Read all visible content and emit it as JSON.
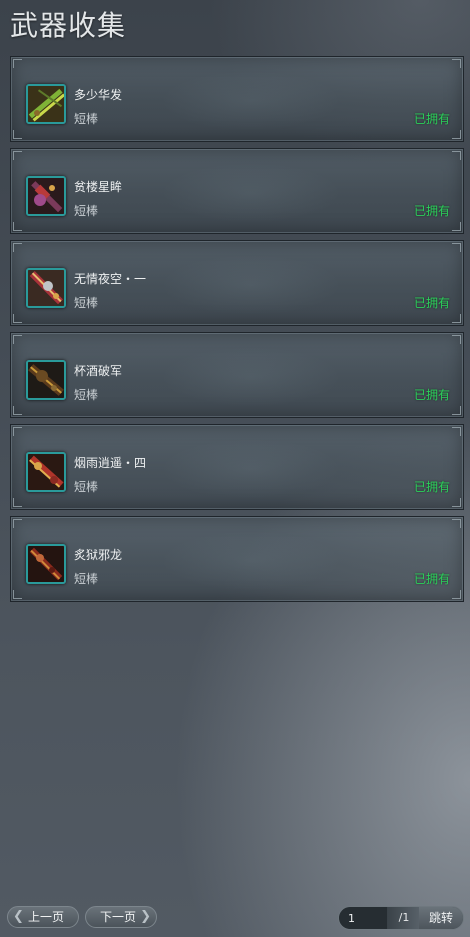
{
  "title": "武器收集",
  "weapons": [
    {
      "name": "多少华发",
      "type": "短棒",
      "status": "已拥有",
      "icon": "weapon-icon-green-rod"
    },
    {
      "name": "贫楼星眸",
      "type": "短棒",
      "status": "已拥有",
      "icon": "weapon-icon-red-purple-club"
    },
    {
      "name": "无情夜空・一",
      "type": "短棒",
      "status": "已拥有",
      "icon": "weapon-icon-red-gold-club"
    },
    {
      "name": "杯酒破军",
      "type": "短棒",
      "status": "已拥有",
      "icon": "weapon-icon-dark-brown-club"
    },
    {
      "name": "烟雨逍遥・四",
      "type": "短棒",
      "status": "已拥有",
      "icon": "weapon-icon-red-gold-rod"
    },
    {
      "name": "炙狱邪龙",
      "type": "短棒",
      "status": "已拥有",
      "icon": "weapon-icon-dark-red-rod"
    }
  ],
  "pagination": {
    "prev_label": "上一页",
    "next_label": "下一页",
    "current_page": "1",
    "total_pages": "/1",
    "jump_label": "跳转"
  },
  "colors": {
    "owned_text": "#2bd15a",
    "icon_frame": "#2a9a9a",
    "title_text": "#e3e6e8"
  }
}
